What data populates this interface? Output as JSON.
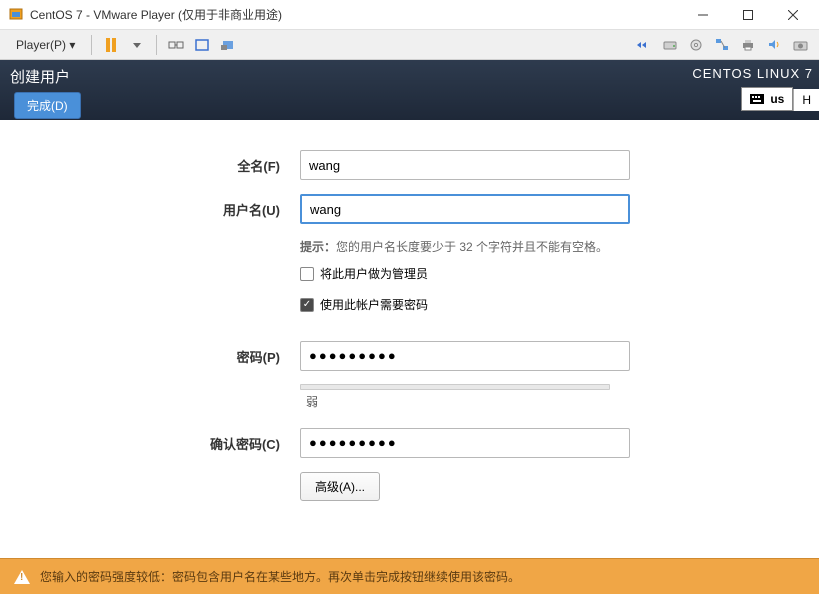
{
  "titlebar": {
    "title": "CentOS 7 - VMware Player (仅用于非商业用途)"
  },
  "toolbar": {
    "player_menu": "Player(P)",
    "dropdown_glyph": "▾"
  },
  "header": {
    "title": "创建用户",
    "done_btn": "完成(D)",
    "brand": "CENTOS LINUX 7",
    "lang": "us",
    "help": "H"
  },
  "form": {
    "fullname_label": "全名(F)",
    "fullname_value": "wang",
    "username_label": "用户名(U)",
    "username_value": "wang",
    "hint_prefix": "提示：",
    "hint_text": "您的用户名长度要少于 32 个字符并且不能有空格。",
    "admin_checkbox": "将此用户做为管理员",
    "require_pw_checkbox": "使用此帐户需要密码",
    "password_label": "密码(P)",
    "password_value": "●●●●●●●●●",
    "strength_label": "弱",
    "confirm_label": "确认密码(C)",
    "confirm_value": "●●●●●●●●●",
    "advanced_btn": "高级(A)..."
  },
  "warning": {
    "text": "您输入的密码强度较低：密码包含用户名在某些地方。再次单击完成按钮继续使用该密码。"
  }
}
